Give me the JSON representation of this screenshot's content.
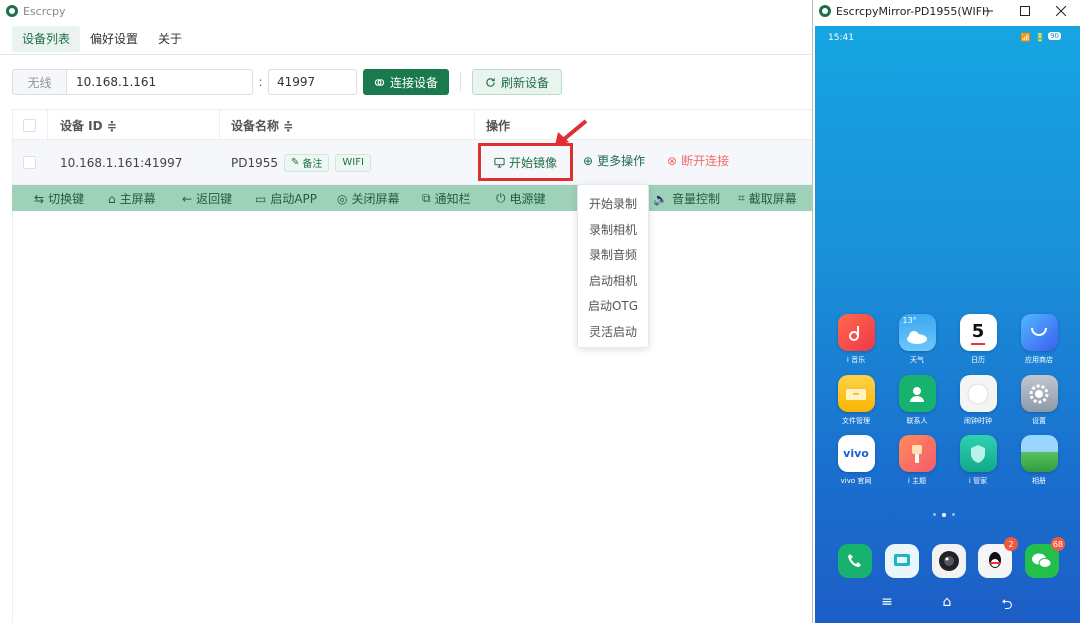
{
  "app": {
    "title": "Escrcpy",
    "tabs": [
      "设备列表",
      "偏好设置",
      "关于"
    ],
    "connect": {
      "prefix": "无线",
      "ip_value": "10.168.1.161",
      "colon": ":",
      "port_value": "41997",
      "connect_label": "连接设备",
      "refresh_label": "刷新设备"
    },
    "table": {
      "headers": {
        "id": "设备 ID ≑",
        "name": "设备名称 ≑",
        "actions": "操作"
      },
      "row": {
        "id": "10.168.1.161:41997",
        "name": "PD1955",
        "note_tag": "备注",
        "wifi_tag": "WIFI",
        "start_mirror": "开始镜像",
        "more_actions": "更多操作",
        "disconnect": "断开连接"
      }
    },
    "toolbar": [
      "切换键",
      "主屏幕",
      "返回键",
      "启动APP",
      "关闭屏幕",
      "通知栏",
      "电源键",
      "音量控制",
      "截取屏幕"
    ],
    "dropdown": [
      "开始录制",
      "录制相机",
      "录制音频",
      "启动相机",
      "启动OTG",
      "灵活启动"
    ],
    "colors": {
      "primary": "#1a7a4e",
      "danger": "#f56c6c",
      "highlight_box": "#e02f2f",
      "toolbar_bg": "#9fd0b8"
    }
  },
  "mirror": {
    "title": "EscrcpyMirror-PD1955(WIFI)",
    "status_time": "15:41",
    "status_icons": "📶 🔋",
    "battery": "90",
    "apps": [
      {
        "label": "i 音乐"
      },
      {
        "label": "天气",
        "text": "13°"
      },
      {
        "label": "日历",
        "text": "5"
      },
      {
        "label": "应用商店"
      },
      {
        "label": "文件管理"
      },
      {
        "label": "联系人"
      },
      {
        "label": "闹钟时钟"
      },
      {
        "label": "设置"
      },
      {
        "label": "vivo 官网",
        "text": "vivo"
      },
      {
        "label": "i 主题"
      },
      {
        "label": "i 管家"
      },
      {
        "label": "相册"
      }
    ],
    "badges": {
      "qq": "2",
      "wechat": "68"
    }
  }
}
